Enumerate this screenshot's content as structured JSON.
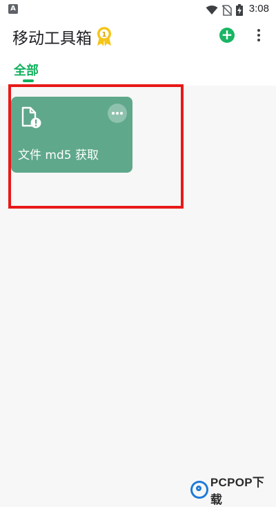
{
  "statusbar": {
    "time": "3:08",
    "notification_icon": "a-icon",
    "icons": [
      "wifi-icon",
      "no-sim-icon",
      "battery-charging-icon"
    ]
  },
  "header": {
    "title": "移动工具箱",
    "badge_icon": "medal-icon",
    "add_icon": "add-icon",
    "more_icon": "more-vert-icon"
  },
  "tabs": [
    {
      "label": "全部",
      "active": true
    }
  ],
  "tools": [
    {
      "label": "文件 md5 获取",
      "icon": "file-info-icon",
      "more_icon": "more-horiz-icon"
    }
  ],
  "colors": {
    "accent": "#12b05e",
    "card": "#5fa88b",
    "highlight": "#e81919"
  },
  "watermark": {
    "text": "PCPOP下载"
  }
}
